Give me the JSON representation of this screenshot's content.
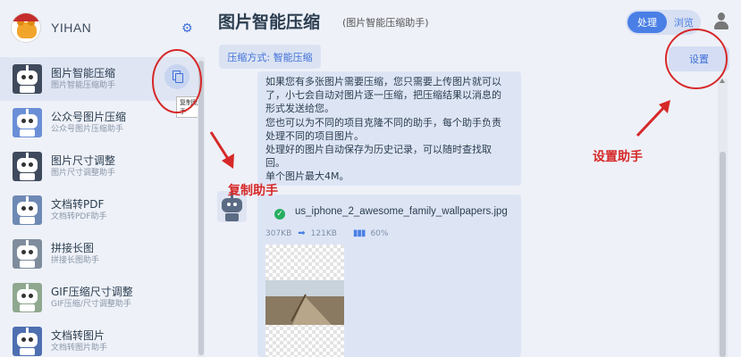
{
  "sidebar": {
    "app_name": "YIHAN",
    "items": [
      {
        "title": "图片智能压缩",
        "subtitle": "图片智能压缩助手",
        "color": "#3f4a5c",
        "active": true
      },
      {
        "title": "公众号图片压缩",
        "subtitle": "公众号图片压缩助手",
        "color": "#6b8fd6"
      },
      {
        "title": "图片尺寸调整",
        "subtitle": "图片尺寸调整助手",
        "color": "#3f4a5c"
      },
      {
        "title": "文档转PDF",
        "subtitle": "文档转PDF助手",
        "color": "#6e89b4"
      },
      {
        "title": "拼接长图",
        "subtitle": "拼接长图助手",
        "color": "#7f8c9c"
      },
      {
        "title": "GIF压缩尺寸调整",
        "subtitle": "GIF压缩/尺寸调整助手",
        "color": "#8fa88f"
      },
      {
        "title": "文档转图片",
        "subtitle": "文档转图片助手",
        "color": "#4e6fb0"
      }
    ],
    "copy_tooltip": "复制助手"
  },
  "header": {
    "title": "图片智能压缩",
    "subtitle": "(图片智能压缩助手)",
    "mode_process": "处理",
    "mode_browse": "浏览"
  },
  "toolbar": {
    "method_label": "压缩方式: 智能压缩",
    "settings_label": "设置"
  },
  "message": {
    "lines": [
      "如果您有多张图片需要压缩，您只需要上传图片就可以",
      "了，小七会自动对图片逐一压缩，把压缩结果以消息的",
      "形式发送给您。",
      "您也可以为不同的项目克隆不同的助手，每个助手负责",
      "处理不同的项目图片。",
      "处理好的图片自动保存为历史记录，可以随时查找取",
      "回。",
      "单个图片最大4M。"
    ]
  },
  "result": {
    "file_name": "us_iphone_2_awesome_family_wallpapers.jpg",
    "original_size": "307KB",
    "compressed_size": "121KB",
    "ratio": "60%"
  },
  "annotations": {
    "copy_assistant": "复制助手",
    "settings_assistant": "设置助手",
    "color": "#d62828"
  }
}
